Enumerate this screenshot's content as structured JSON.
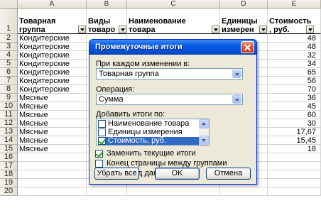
{
  "sheet": {
    "columns": [
      "A",
      "B",
      "C",
      "D",
      "E"
    ],
    "header": {
      "col_a": [
        "Товарная",
        "группа"
      ],
      "col_b": [
        "Виды",
        "товаро"
      ],
      "col_c": [
        "Наименование",
        "товара"
      ],
      "col_d": [
        "Единицы",
        "измерен"
      ],
      "col_e": [
        "Стоимость",
        ", руб."
      ]
    },
    "row_numbers": [
      "1",
      "2",
      "3",
      "4",
      "5",
      "6",
      "7",
      "8",
      "9",
      "10",
      "11",
      "12",
      "13",
      "14",
      "15",
      "16",
      "17",
      "18",
      "19",
      "20"
    ],
    "rows": [
      {
        "group": "Кондитерские",
        "cost": "48"
      },
      {
        "group": "Кондитерские",
        "cost": "48"
      },
      {
        "group": "Кондитерские",
        "cost": "32"
      },
      {
        "group": "Кондитерские",
        "cost": "34"
      },
      {
        "group": "Кондитерские",
        "cost": "65"
      },
      {
        "group": "Кондитерские",
        "cost": "56"
      },
      {
        "group": "Кондитерские",
        "cost": "70"
      },
      {
        "group": "Мясные",
        "cost": "36"
      },
      {
        "group": "Мясные",
        "cost": "45"
      },
      {
        "group": "Мясные",
        "cost": "60"
      },
      {
        "group": "Мясные",
        "cost": "30"
      },
      {
        "group": "Мясные",
        "cost": "17,67"
      },
      {
        "group": "Мясные",
        "cost": "15,45"
      },
      {
        "group": "Мясные",
        "cost": "18"
      }
    ]
  },
  "dialog": {
    "title": "Промежуточные итоги",
    "group_by_label": "При каждом изменении в:",
    "group_by_value": "Товарная группа",
    "operation_label": "Операция:",
    "operation_value": "Сумма",
    "add_totals_label": "Добавить итоги по:",
    "fields": [
      {
        "label": "Наименование товара",
        "checked": false
      },
      {
        "label": "Единицы измерения",
        "checked": false
      },
      {
        "label": "Стоимость, руб.",
        "checked": true
      }
    ],
    "replace_current": "Заменить текущие итоги",
    "page_break": "Конец страницы между группами",
    "summary_below": "Итоги под данными",
    "remove_all": "Убрать все",
    "ok": "OK",
    "cancel": "Отмена"
  },
  "colors": {
    "title_blue": "#0553e0",
    "selection_blue": "#316ac5",
    "dialog_bg": "#ece9d8"
  }
}
